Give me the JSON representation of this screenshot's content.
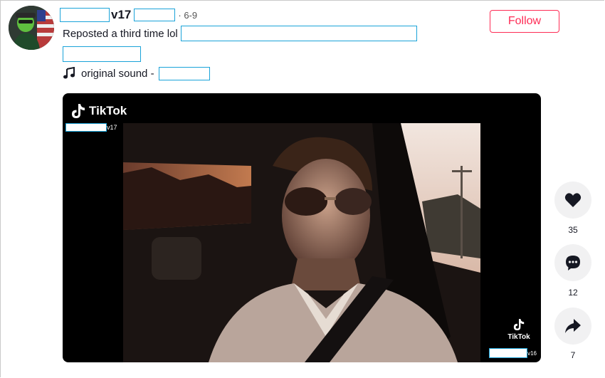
{
  "post": {
    "username_suffix": "v17",
    "date": "· 6-9",
    "caption": "Reposted a third time lol",
    "sound_label": "original sound -",
    "follow_label": "Follow"
  },
  "video": {
    "watermark_brand": "TikTok",
    "watermark_user_suffix": "v17",
    "watermark_bottom_brand": "TikTok",
    "watermark_bottom_user_suffix": "v16"
  },
  "actions": {
    "likes": "35",
    "comments": "12",
    "shares": "7"
  },
  "colors": {
    "accent": "#fe2c55",
    "redaction_border": "#1aa3d9",
    "action_bg": "#f1f1f2"
  },
  "icons": {
    "like": "heart-icon",
    "comment": "comment-icon",
    "share": "share-arrow-icon",
    "music": "music-note-icon",
    "brand": "tiktok-logo-icon"
  }
}
